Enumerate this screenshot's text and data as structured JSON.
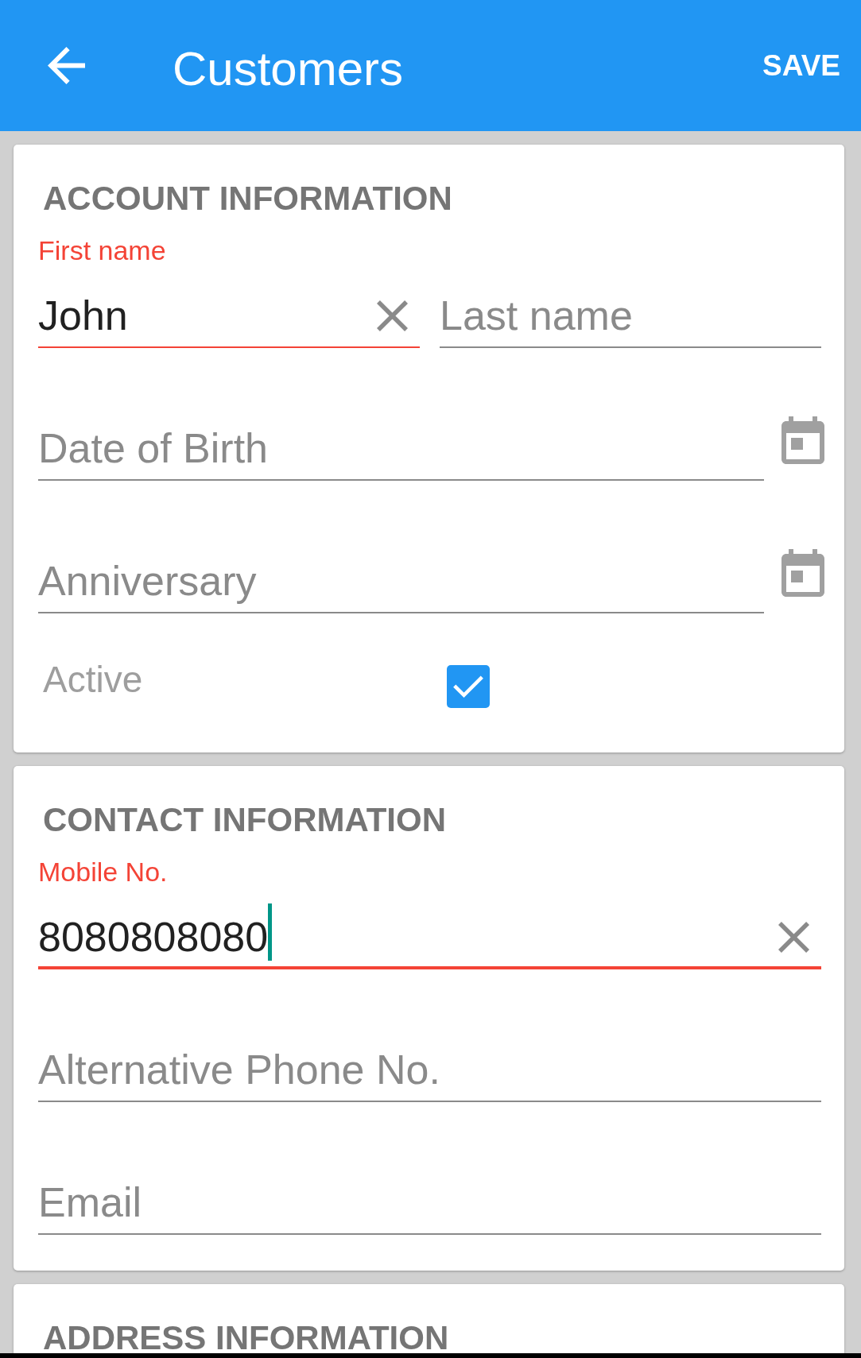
{
  "app_bar": {
    "title": "Customers",
    "action": "SAVE"
  },
  "sections": [
    {
      "title": "ACCOUNT INFORMATION",
      "rows": [
        {
          "kind": "fields",
          "fields": [
            {
              "kind": "text",
              "label": "First name",
              "value": "John",
              "invalid": true,
              "focused": false
            },
            {
              "kind": "text",
              "placeholder": "Last name",
              "invalid": false,
              "focused": false
            }
          ]
        },
        {
          "kind": "fields",
          "fields": [
            {
              "kind": "date",
              "placeholder": "Date of Birth",
              "invalid": false,
              "focused": false
            }
          ]
        },
        {
          "kind": "fields",
          "fields": [
            {
              "kind": "date",
              "placeholder": "Anniversary",
              "invalid": false,
              "focused": false
            }
          ]
        },
        {
          "kind": "checkbox",
          "label": "Active",
          "checked": true
        }
      ]
    },
    {
      "title": "CONTACT INFORMATION",
      "rows": [
        {
          "kind": "fields",
          "fields": [
            {
              "kind": "text",
              "label": "Mobile No.",
              "value": "8080808080",
              "invalid": true,
              "focused": true
            }
          ]
        },
        {
          "kind": "fields",
          "fields": [
            {
              "kind": "text",
              "placeholder": "Alternative Phone No.",
              "invalid": false,
              "focused": false
            }
          ]
        },
        {
          "kind": "fields",
          "fields": [
            {
              "kind": "text",
              "placeholder": "Email",
              "invalid": false,
              "focused": false
            }
          ]
        }
      ]
    },
    {
      "title": "ADDRESS INFORMATION"
    }
  ]
}
